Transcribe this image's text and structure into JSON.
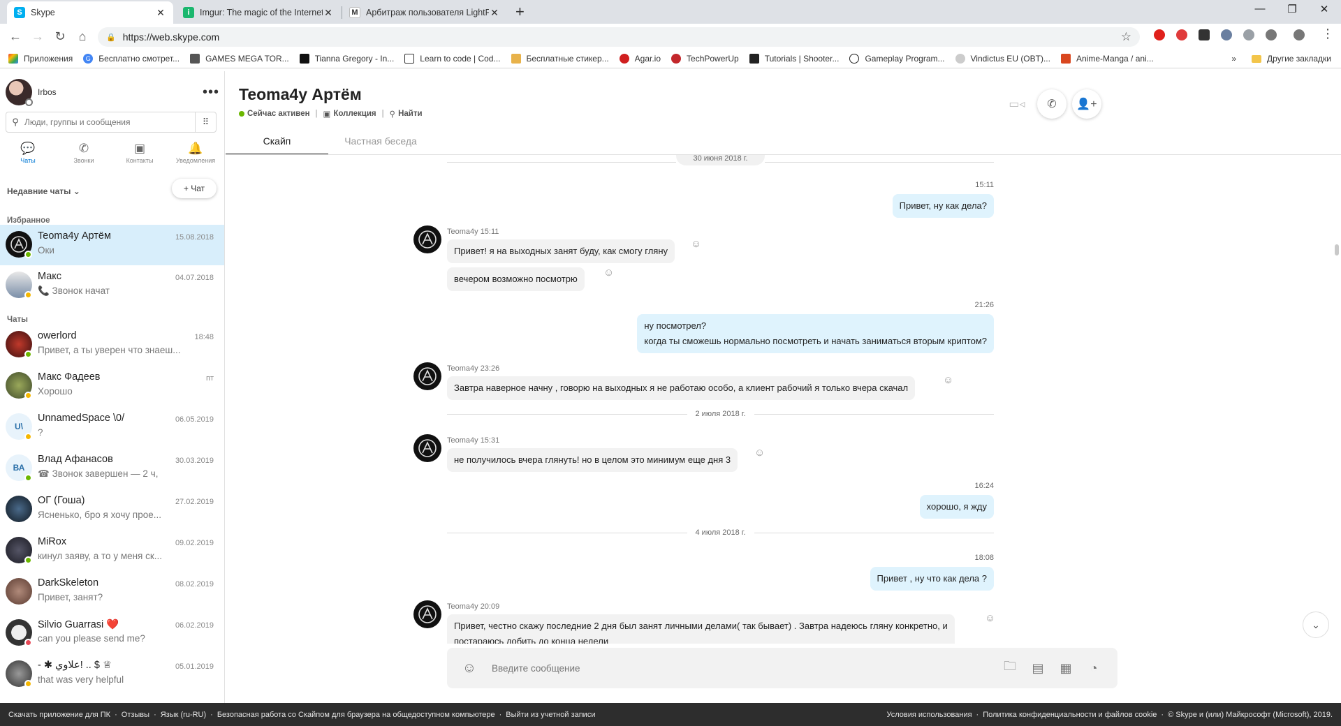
{
  "browser": {
    "tabs": [
      {
        "title": "Skype",
        "icon": "skype-icon"
      },
      {
        "title": "Imgur: The magic of the Internet",
        "icon": "imgur-icon"
      },
      {
        "title": "Арбитраж пользователя LightF",
        "icon": "lightf-icon"
      }
    ],
    "url": "https://web.skype.com",
    "bookmarks": [
      "Приложения",
      "Бесплатно смотрет...",
      "GAMES MEGA TOR...",
      "Tianna Gregory - In...",
      "Learn to code | Cod...",
      "Бесплатные стикер...",
      "Agar.io",
      "TechPowerUp",
      "Tutorials | Shooter...",
      "Gameplay Program...",
      "Vindictus EU (OBT)...",
      "Anime-Manga / ani..."
    ],
    "bookmarks_more": "»",
    "other_bookmarks": "Другие закладки"
  },
  "sidebar": {
    "user_name": "Irbos",
    "search_placeholder": "Люди, группы и сообщения",
    "nav": [
      "Чаты",
      "Звонки",
      "Контакты",
      "Уведомления"
    ],
    "recent_label": "Недавние чаты ⌄",
    "new_chat": "+ Чат",
    "favorites_label": "Избранное",
    "chats_label": "Чаты",
    "favorites": [
      {
        "name": "Teoma4y Артём",
        "preview": "Оки",
        "time": "15.08.2018",
        "status": "#6bb700"
      },
      {
        "name": "Макс",
        "preview": "📞 Звонок начат",
        "time": "04.07.2018",
        "status": "#f5b700"
      }
    ],
    "chats": [
      {
        "name": "owerlord",
        "preview": "Привет, а ты уверен что знаеш...",
        "time": "18:48",
        "status": "#6bb700"
      },
      {
        "name": "Макс Фадеев",
        "preview": "Хорошо",
        "time": "пт",
        "status": "#f5b700"
      },
      {
        "name": "UnnamedSpace \\0/",
        "preview": "?",
        "time": "06.05.2019",
        "status": "#f5b700"
      },
      {
        "name": "Влад Афанасов",
        "preview": "☎ Звонок завершен — 2 ч,",
        "time": "30.03.2019",
        "status": "#6bb700"
      },
      {
        "name": "ОГ (Гоша)",
        "preview": "Ясненько, бро я хочу прое...",
        "time": "27.02.2019",
        "status": ""
      },
      {
        "name": "MiRox",
        "preview": "кинул заяву, а то у меня ск...",
        "time": "09.02.2019",
        "status": "#6bb700"
      },
      {
        "name": "DarkSkeleton",
        "preview": "Привет, занят?",
        "time": "08.02.2019",
        "status": ""
      },
      {
        "name": "Silvio Guarrasi ❤️",
        "preview": "can you please send me?",
        "time": "06.02.2019",
        "status": "#e74856"
      },
      {
        "name": "- ✱ علاوي! .. $ ♕",
        "preview": "that was very helpful",
        "time": "05.01.2019",
        "status": "#f5b700"
      }
    ]
  },
  "conversation": {
    "title": "Teoma4y Артём",
    "status": "Сейчас активен",
    "collection": "Коллекция",
    "find": "Найти",
    "tabs": [
      "Скайп",
      "Частная беседа"
    ],
    "dates": [
      "30 июня 2018 г.",
      "2 июля 2018 г.",
      "4 июля 2018 г."
    ],
    "messages": [
      {
        "dir": "out",
        "time": "15:11",
        "lines": [
          "Привет, ну как дела?"
        ]
      },
      {
        "dir": "in",
        "meta": "Teoma4y 15:11",
        "lines": [
          "Привет! я на выходных занят буду, как смогу гляну"
        ]
      },
      {
        "dir": "in",
        "lines": [
          "вечером возможно посмотрю"
        ]
      },
      {
        "dir": "out",
        "time": "21:26",
        "lines": [
          "ну посмотрел?",
          "когда ты сможешь нормально посмотреть и начать заниматься вторым криптом?"
        ]
      },
      {
        "dir": "in",
        "meta": "Teoma4y 23:26",
        "lines": [
          "Завтра наверное начну , говорю на выходных я не работаю особо, а клиент рабочий я только вчера скачал"
        ]
      },
      {
        "dir": "in",
        "meta": "Teoma4y 15:31",
        "lines": [
          "не получилось вчера глянуть! но в целом это минимум еще дня 3"
        ]
      },
      {
        "dir": "out",
        "time": "16:24",
        "lines": [
          "хорошо, я жду"
        ]
      },
      {
        "dir": "out",
        "time": "18:08",
        "lines": [
          "Привет , ну что как дела ?"
        ]
      },
      {
        "dir": "in",
        "meta": "Teoma4y 20:09",
        "lines": [
          "Привет, честно скажу последние 2 дня был занят личными делами( так бывает) . Завтра надеюсь гляну конкретно, и",
          "постараюсь добить до конца недели"
        ]
      }
    ],
    "composer_placeholder": "Введите сообщение"
  },
  "footer": {
    "left": [
      "Скачать приложение для ПК",
      "·",
      "Отзывы",
      "·",
      "Язык (ru-RU)",
      "·",
      "Безопасная работа со Скайпом для браузера на общедоступном компьютере",
      "·",
      "Выйти из учетной записи"
    ],
    "right": [
      "Условия использования",
      "·",
      "Политика конфиденциальности и файлов cookie",
      "·",
      "© Skype и (или) Майкрософт (Microsoft), 2019."
    ]
  },
  "colors": {
    "accent": "#0078d4",
    "online": "#6bb700",
    "away": "#f5b700",
    "outgoing_bubble": "#dff3fd",
    "incoming_bubble": "#f2f2f2"
  }
}
